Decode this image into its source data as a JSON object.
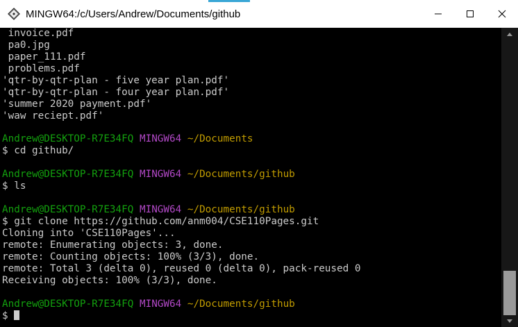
{
  "window": {
    "title": "MINGW64:/c/Users/Andrew/Documents/github",
    "accent_color": "#3aa7d6"
  },
  "controls": {
    "minimize_icon": "minimize-icon",
    "maximize_icon": "maximize-icon",
    "close_icon": "close-icon"
  },
  "colors": {
    "user_host": "#13a10e",
    "mingw": "#b148c6",
    "path": "#c19c00",
    "text": "#cccccc"
  },
  "terminal": {
    "lines": [
      [
        {
          "t": " invoice.pdf",
          "c": "text"
        }
      ],
      [
        {
          "t": " pa0.jpg",
          "c": "text"
        }
      ],
      [
        {
          "t": " paper_111.pdf",
          "c": "text"
        }
      ],
      [
        {
          "t": " problems.pdf",
          "c": "text"
        }
      ],
      [
        {
          "t": "'qtr-by-qtr-plan - five year plan.pdf'",
          "c": "text"
        }
      ],
      [
        {
          "t": "'qtr-by-qtr-plan - four year plan.pdf'",
          "c": "text"
        }
      ],
      [
        {
          "t": "'summer 2020 payment.pdf'",
          "c": "text"
        }
      ],
      [
        {
          "t": "'waw reciept.pdf'",
          "c": "text"
        }
      ],
      [],
      [
        {
          "t": "Andrew@DESKTOP-R7E34FQ ",
          "c": "user_host"
        },
        {
          "t": "MINGW64 ",
          "c": "mingw"
        },
        {
          "t": "~/Documents",
          "c": "path"
        }
      ],
      [
        {
          "t": "$ cd github/",
          "c": "text"
        }
      ],
      [],
      [
        {
          "t": "Andrew@DESKTOP-R7E34FQ ",
          "c": "user_host"
        },
        {
          "t": "MINGW64 ",
          "c": "mingw"
        },
        {
          "t": "~/Documents/github",
          "c": "path"
        }
      ],
      [
        {
          "t": "$ ls",
          "c": "text"
        }
      ],
      [],
      [
        {
          "t": "Andrew@DESKTOP-R7E34FQ ",
          "c": "user_host"
        },
        {
          "t": "MINGW64 ",
          "c": "mingw"
        },
        {
          "t": "~/Documents/github",
          "c": "path"
        }
      ],
      [
        {
          "t": "$ git clone https://github.com/anm004/CSE110Pages.git",
          "c": "text"
        }
      ],
      [
        {
          "t": "Cloning into 'CSE110Pages'...",
          "c": "text"
        }
      ],
      [
        {
          "t": "remote: Enumerating objects: 3, done.",
          "c": "text"
        }
      ],
      [
        {
          "t": "remote: Counting objects: 100% (3/3), done.",
          "c": "text"
        }
      ],
      [
        {
          "t": "remote: Total 3 (delta 0), reused 0 (delta 0), pack-reused 0",
          "c": "text"
        }
      ],
      [
        {
          "t": "Receiving objects: 100% (3/3), done.",
          "c": "text"
        }
      ],
      [],
      [
        {
          "t": "Andrew@DESKTOP-R7E34FQ ",
          "c": "user_host"
        },
        {
          "t": "MINGW64 ",
          "c": "mingw"
        },
        {
          "t": "~/Documents/github",
          "c": "path"
        }
      ],
      [
        {
          "t": "$",
          "c": "text"
        }
      ]
    ]
  }
}
